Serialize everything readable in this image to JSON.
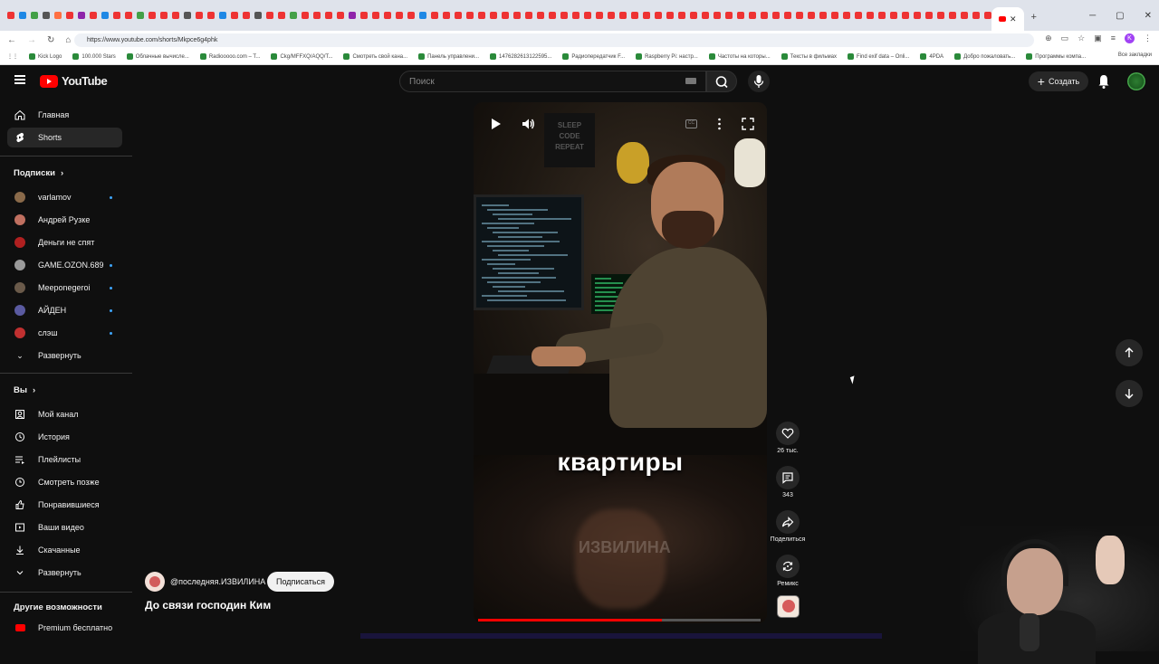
{
  "browser": {
    "tab_title": "",
    "url": "https://www.youtube.com/shorts/Mkpce6g4phk",
    "bookmarks": [
      "Kick Logo",
      "100.000 Stars",
      "Облачные вычисле...",
      "Radiooooo.com – T...",
      "Ckg/MFFXQ/AQQ/T...",
      "Смотреть свой кана...",
      "Панель управлени...",
      "1476282613122595...",
      "Радиопередатчик F...",
      "Raspberry Pi: настр...",
      "Частоты на которы...",
      "Тексты в фильмах",
      "Find exif data – Onli...",
      "4PDA",
      "Добро пожаловать...",
      "Программы компа..."
    ],
    "bookmarks_all": "Все закладки",
    "profile_initial": "K"
  },
  "yt": {
    "logo_text": "YouTube",
    "search_placeholder": "Поиск",
    "create_label": "Создать",
    "sidebar": {
      "main": [
        {
          "label": "Главная",
          "icon": "home-icon"
        },
        {
          "label": "Shorts",
          "icon": "shorts-icon"
        }
      ],
      "subs_header": "Подписки",
      "subs": [
        {
          "label": "varlamov",
          "color": "#8a6a4a",
          "dot": true
        },
        {
          "label": "Андрей Рузке",
          "color": "#c07060",
          "dot": false
        },
        {
          "label": "Деньги не спят",
          "color": "#b02020",
          "dot": false
        },
        {
          "label": "GAME.OZON.689",
          "color": "#9a9a9a",
          "dot": true
        },
        {
          "label": "Meeponegeroi",
          "color": "#6a5a4a",
          "dot": true
        },
        {
          "label": "АЙДЕН",
          "color": "#5a5aa0",
          "dot": true
        },
        {
          "label": "слэш",
          "color": "#c03030",
          "dot": true
        }
      ],
      "subs_expand": "Развернуть",
      "you_header": "Вы",
      "you": [
        {
          "label": "Мой канал"
        },
        {
          "label": "История"
        },
        {
          "label": "Плейлисты"
        },
        {
          "label": "Смотреть позже"
        },
        {
          "label": "Понравившиеся"
        },
        {
          "label": "Ваши видео"
        },
        {
          "label": "Скачанные"
        },
        {
          "label": "Развернуть"
        }
      ],
      "more_header": "Другие возможности",
      "premium": "Premium бесплатно"
    },
    "video": {
      "caption": "квартиры",
      "poster_text": "SLEEP CODE REPEAT",
      "overlay_text": "ИЗВИЛИНА",
      "progress": 0.65
    },
    "actions": {
      "likes": "26 тыс.",
      "comments": "343",
      "share": "Поделиться",
      "remix": "Ремикс"
    },
    "channel": {
      "name": "@последняя.ИЗВИЛИНА",
      "subscribe": "Подписаться",
      "title": "До связи господин Ким"
    }
  }
}
